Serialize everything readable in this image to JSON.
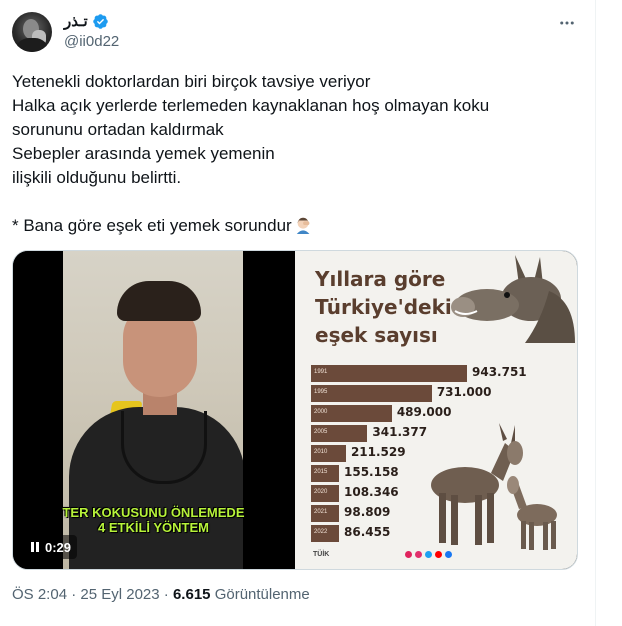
{
  "tweet": {
    "display_name": "تـذر",
    "handle": "@ii0d22",
    "text_lines": [
      "Yetenekli doktorlardan biri birçok tavsiye veriyor",
      "Halka açık yerlerde terlemeden kaynaklanan hoş olmayan koku",
      "sorununu ortadan kaldırmak",
      "Sebepler arasında yemek yemenin",
      "ilişkili olduğunu belirtti.",
      "",
      "* Bana göre eşek eti yemek sorundur"
    ],
    "emoji": "man-facepalming-emoji",
    "time": "ÖS 2:04",
    "date": "25 Eyl 2023",
    "separator": "·",
    "views_count": "6.615",
    "views_label": "Görüntülenme"
  },
  "video": {
    "caption_line1": "TER KOKUSUNU ÖNLEMEDE",
    "caption_line2": "4 ETKİLİ YÖNTEM",
    "duration": "0:29",
    "pause_icon": "pause-icon"
  },
  "infographic": {
    "title_line1": "Yıllara göre",
    "title_line2": "Türkiye'deki",
    "title_line3": "eşek sayısı",
    "source": "TÜİK",
    "chart_data": {
      "type": "bar",
      "categories": [
        "1991",
        "1995",
        "2000",
        "2005",
        "2010",
        "2015",
        "2020",
        "2021",
        "2022"
      ],
      "values": [
        943751,
        731000,
        489000,
        341377,
        211529,
        155158,
        108346,
        98809,
        86455
      ],
      "value_labels": [
        "943.751",
        "731.000",
        "489.000",
        "341.377",
        "211.529",
        "155.158",
        "108.346",
        "98.809",
        "86.455"
      ],
      "title": "Yıllara göre Türkiye'deki eşek sayısı",
      "xlabel": "",
      "ylabel": ""
    }
  },
  "colors": {
    "verified": "#1d9bf0",
    "text": "#0f1419",
    "secondary": "#536471",
    "bar": "#6b4a3a",
    "caption": "#b7f33a"
  }
}
